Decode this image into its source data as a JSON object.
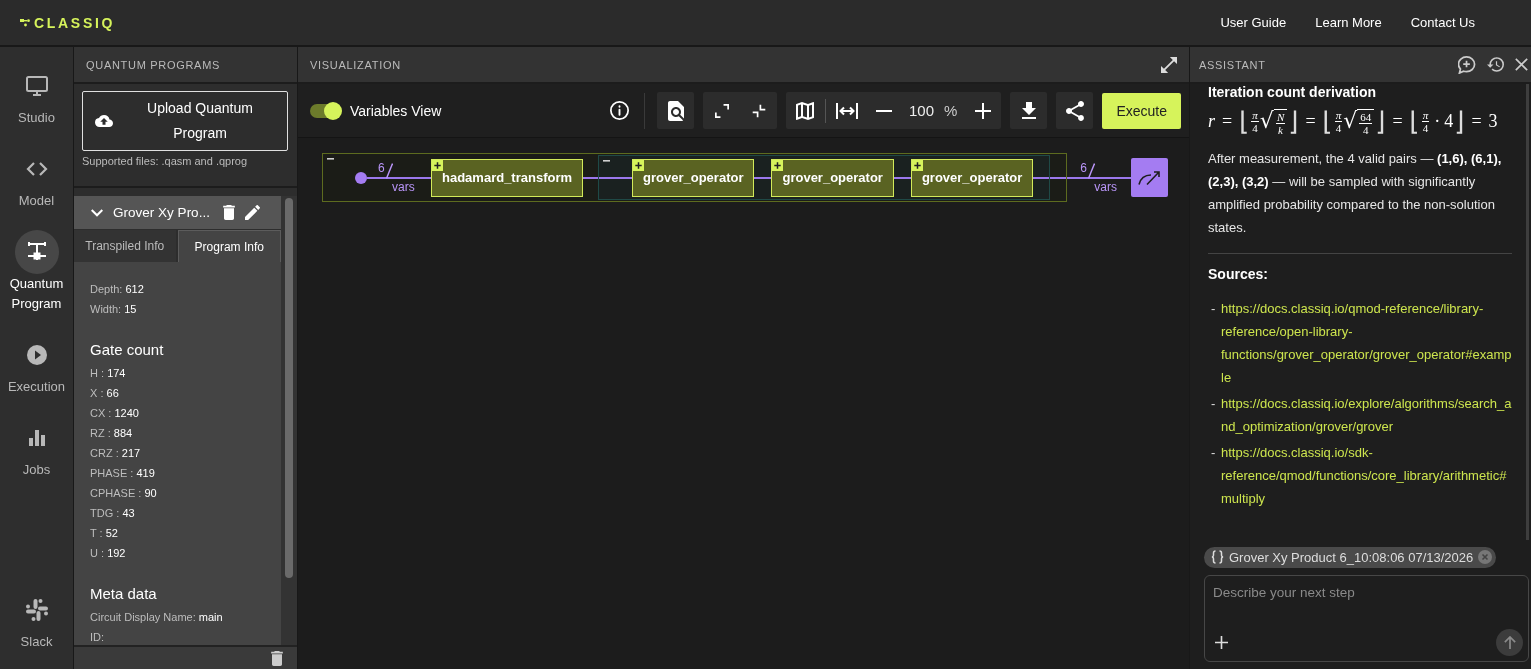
{
  "header": {
    "logo": "CLASSIQ",
    "nav": [
      "User Guide",
      "Learn More",
      "Contact Us"
    ]
  },
  "rail": {
    "items": [
      {
        "label": "Studio",
        "selected": false
      },
      {
        "label": "Model",
        "selected": false
      },
      {
        "label": "Quantum Program",
        "selected": true
      },
      {
        "label": "Execution",
        "selected": false
      },
      {
        "label": "Jobs",
        "selected": false
      }
    ],
    "footer_item": {
      "label": "Slack"
    }
  },
  "programs_panel": {
    "title": "QUANTUM PROGRAMS",
    "upload_button": "Upload Quantum Program",
    "supported_files": "Supported files: .qasm and .qprog",
    "program": {
      "name": "Grover Xy Pro...",
      "expanded": true,
      "tabs": [
        {
          "label": "Transpiled Info",
          "selected": false
        },
        {
          "label": "Program Info",
          "selected": true
        }
      ],
      "stats": [
        {
          "label": "Depth:",
          "value": "612"
        },
        {
          "label": "Width:",
          "value": "15"
        }
      ],
      "gate_count": {
        "title": "Gate count",
        "gates": [
          {
            "label": "H :",
            "value": "174"
          },
          {
            "label": "X :",
            "value": "66"
          },
          {
            "label": "CX :",
            "value": "1240"
          },
          {
            "label": "RZ :",
            "value": "884"
          },
          {
            "label": "CRZ :",
            "value": "217"
          },
          {
            "label": "PHASE :",
            "value": "419"
          },
          {
            "label": "CPHASE :",
            "value": "90"
          },
          {
            "label": "TDG :",
            "value": "43"
          },
          {
            "label": "T :",
            "value": "52"
          },
          {
            "label": "U :",
            "value": "192"
          }
        ]
      },
      "meta_data": {
        "title": "Meta data",
        "fields": [
          {
            "label": "Circuit Display Name:",
            "value": "main"
          },
          {
            "label": "ID:"
          }
        ]
      }
    }
  },
  "visualization": {
    "title": "VISUALIZATION",
    "toolbar": {
      "variables_view": {
        "label": "Variables View",
        "on": true
      },
      "zoom_value": "100",
      "zoom_unit": "%",
      "execute_button": "Execute"
    },
    "circuit": {
      "expanded": true,
      "input": {
        "count": "6",
        "label": "vars"
      },
      "children": [
        {
          "label": "hadamard_transform",
          "expanded": false
        },
        {
          "expanded": true,
          "children": [
            {
              "label": "grover_operator",
              "expanded": false
            },
            {
              "label": "grover_operator",
              "expanded": false
            },
            {
              "label": "grover_operator",
              "expanded": false
            }
          ]
        }
      ],
      "output": {
        "count": "6",
        "label": "vars"
      }
    }
  },
  "assistant": {
    "title": "ASSISTANT",
    "heading": "Iteration count derivation",
    "formula": [
      {
        "kind": "var",
        "text": "r"
      },
      {
        "kind": "op",
        "text": "="
      },
      {
        "kind": "bracket",
        "open": "⌊",
        "close": "⌋",
        "body": [
          {
            "kind": "frac",
            "num": [
              {
                "kind": "var",
                "text": "π"
              }
            ],
            "den": [
              {
                "kind": "num",
                "text": "4"
              }
            ]
          },
          {
            "kind": "sqrt",
            "sign": "√",
            "body": [
              {
                "kind": "frac",
                "num": [
                  {
                    "kind": "var",
                    "text": "N"
                  }
                ],
                "den": [
                  {
                    "kind": "var",
                    "text": "k"
                  }
                ]
              }
            ]
          }
        ]
      },
      {
        "kind": "op",
        "text": "="
      },
      {
        "kind": "bracket",
        "open": "⌊",
        "close": "⌋",
        "body": [
          {
            "kind": "frac",
            "num": [
              {
                "kind": "var",
                "text": "π"
              }
            ],
            "den": [
              {
                "kind": "num",
                "text": "4"
              }
            ]
          },
          {
            "kind": "sqrt",
            "sign": "√",
            "body": [
              {
                "kind": "frac",
                "num": [
                  {
                    "kind": "num",
                    "text": "64"
                  }
                ],
                "den": [
                  {
                    "kind": "num",
                    "text": "4"
                  }
                ]
              }
            ]
          }
        ]
      },
      {
        "kind": "op",
        "text": "="
      },
      {
        "kind": "bracket",
        "open": "⌊",
        "close": "⌋",
        "body": [
          {
            "kind": "frac",
            "num": [
              {
                "kind": "var",
                "text": "π"
              }
            ],
            "den": [
              {
                "kind": "num",
                "text": "4"
              }
            ]
          },
          {
            "kind": "op",
            "text": "·"
          },
          {
            "kind": "num",
            "text": "4"
          }
        ]
      },
      {
        "kind": "op",
        "text": "="
      },
      {
        "kind": "num",
        "text": "3"
      }
    ],
    "paragraph": "After measurement, the 4 valid pairs — **(1,6), (6,1), (2,3), (3,2)** — will be sampled with significantly amplified probability compared to the non-solution states.",
    "sources_title": "Sources:",
    "sources": [
      {
        "marker": "-",
        "url": "https://docs.classiq.io/qmod-reference/library-reference/open-library-functions/grover_operator/grover_operator#example"
      },
      {
        "marker": "-",
        "url": "https://docs.classiq.io/explore/algorithms/search_and_optimization/grover/grover"
      },
      {
        "marker": "-",
        "url": "https://docs.classiq.io/sdk-reference/qmod/functions/core_library/arithmetic#multiply"
      }
    ],
    "context_chip": "Grover Xy Product 6_10:08:06 07/13/2026",
    "input": {
      "placeholder": "Describe your next step"
    }
  }
}
